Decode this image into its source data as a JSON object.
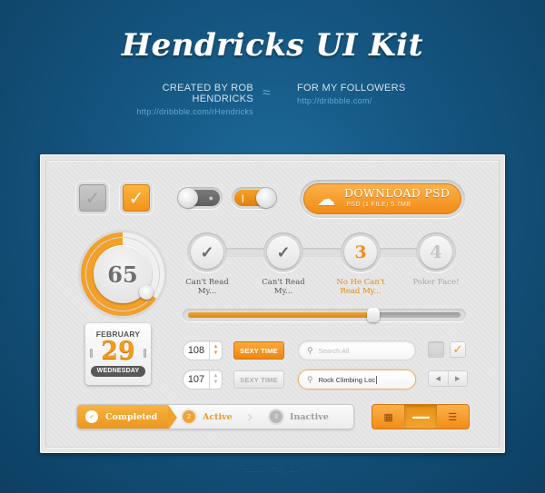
{
  "header": {
    "title": "Hendricks UI Kit",
    "credit_left": "CREATED BY ROB HENDRICKS",
    "credit_left_link": "http://dribbble.com/rHendricks",
    "divider": "≈",
    "credit_right": "FOR MY FOLLOWERS",
    "credit_right_link": "http://dribbble.com/"
  },
  "checkboxes": [
    {
      "checked": false,
      "icon": "✓"
    },
    {
      "checked": true,
      "icon": "✓"
    }
  ],
  "toggles": [
    {
      "state": "off",
      "mark": "●"
    },
    {
      "state": "on",
      "mark": "|"
    }
  ],
  "download": {
    "icon": "cloud-download-icon",
    "glyph": "☁",
    "label": "DOWNLOAD PSD",
    "sublabel": ".PSD (1 FILE) 5.7MB"
  },
  "gauge": {
    "value": "65",
    "percent": 65
  },
  "steps": [
    {
      "face": "✓",
      "state": "done",
      "label_1": "Can't Read",
      "label_2": "My..."
    },
    {
      "face": "✓",
      "state": "done",
      "label_1": "Can't Read",
      "label_2": "My..."
    },
    {
      "face": "3",
      "state": "active",
      "label_1": "No He Can't",
      "label_2": "Read My..."
    },
    {
      "face": "4",
      "state": "pending",
      "label_1": "Poker Face!",
      "label_2": ""
    }
  ],
  "slider": {
    "value_percent": 68
  },
  "calendar": {
    "month": "FEBRUARY",
    "day": "29",
    "weekday": "WEDNESDAY"
  },
  "steppers": [
    {
      "value": "108",
      "up": "▲",
      "down": "▼"
    },
    {
      "value": "107",
      "up": "▲",
      "down": "▼"
    }
  ],
  "buttons": [
    {
      "label": "SEXY TIME",
      "state": "active"
    },
    {
      "label": "SEXY TIME",
      "state": "default"
    }
  ],
  "searches": [
    {
      "placeholder": "Search All",
      "value": ""
    },
    {
      "placeholder": "",
      "value": "Rock Climbing Loc"
    }
  ],
  "small_checkboxes": [
    {
      "checked": false
    },
    {
      "checked": true,
      "icon": "✓"
    }
  ],
  "pager": {
    "prev": "◀",
    "next": "▶"
  },
  "progress_crumbs": [
    {
      "num": "✓",
      "label": "Completed",
      "state": "completed"
    },
    {
      "num": "2",
      "label": "Active",
      "state": "active"
    },
    {
      "num": "3",
      "label": "Inactive",
      "state": "inactive"
    }
  ],
  "view_switcher": {
    "options": [
      {
        "name": "grid",
        "glyph": "▦"
      },
      {
        "name": "columns",
        "glyph": "▬▬▬"
      },
      {
        "name": "list",
        "glyph": "☰"
      }
    ],
    "selected": "columns"
  },
  "signature": "Rob ♡'s you",
  "colors": {
    "accent": "#f39b1d",
    "background": "#145580",
    "panel": "#e6e6e6"
  }
}
